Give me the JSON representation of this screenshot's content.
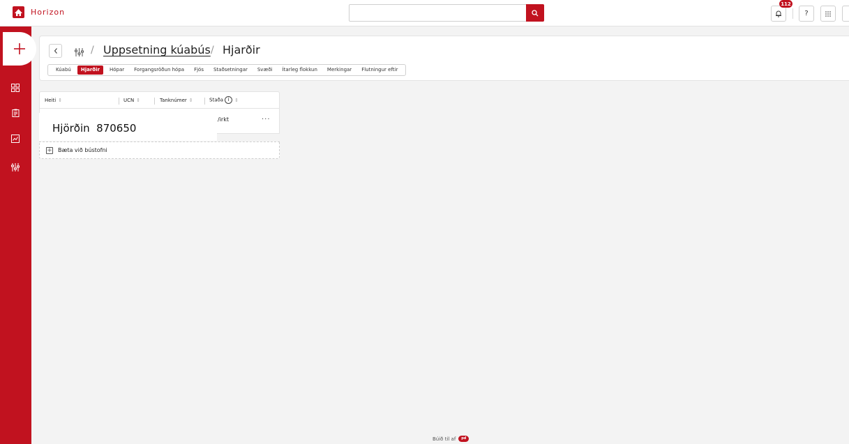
{
  "app": {
    "name": "Horizon"
  },
  "search": {
    "placeholder": "",
    "value": ""
  },
  "notifications": {
    "count": "112"
  },
  "top_actions": {
    "help_label": "?"
  },
  "breadcrumb": {
    "link": "Uppsetning kúabús",
    "separator": "/",
    "current": "Hjarðir"
  },
  "tabs": [
    {
      "label": "Kúabú"
    },
    {
      "label": "Hjarðir"
    },
    {
      "label": "Hópar"
    },
    {
      "label": "Forgangsröðun hópa"
    },
    {
      "label": "Fjós"
    },
    {
      "label": "Staðsetningar"
    },
    {
      "label": "Svæði"
    },
    {
      "label": "Ítarleg flokkun"
    },
    {
      "label": "Merkingar"
    },
    {
      "label": "Flutningur eftir"
    }
  ],
  "table": {
    "headers": {
      "name": "Heiti",
      "ucn": "UCN",
      "tank": "Tanknúmer",
      "status": "Staða"
    },
    "sort_glyph": "⇕",
    "info_glyph": "i",
    "row": {
      "status": "/irkt",
      "menu": "···"
    },
    "add_label": "Bæta við bústofni"
  },
  "tooltip": {
    "text": "Hjörðin  870650"
  },
  "footer": {
    "text": "Búið til af",
    "logo_text": "pd"
  }
}
